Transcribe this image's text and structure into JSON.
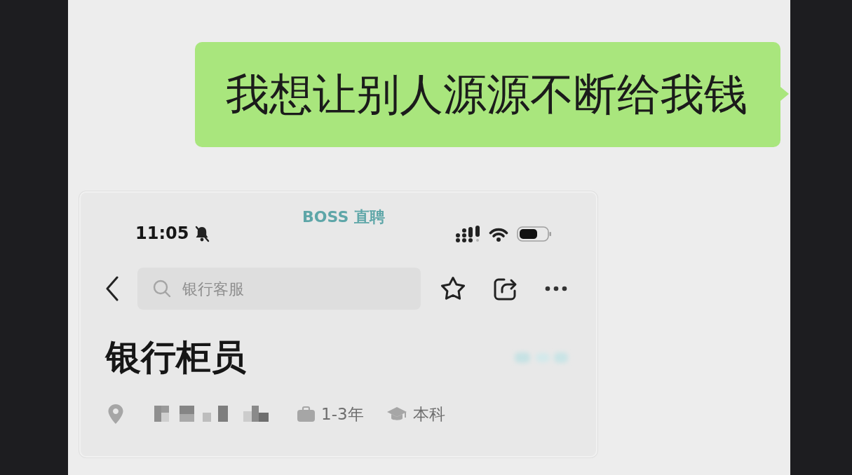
{
  "chat": {
    "messages": [
      {
        "kind": "text",
        "outgoing": true,
        "text": "我想让别人源源不断给我钱"
      },
      {
        "kind": "screenshot",
        "outgoing": false,
        "screenshot": {
          "status_bar": {
            "time": "11:05",
            "muted": true,
            "app_logo": "BOSS 直聘"
          },
          "search": {
            "placeholder": "银行客服"
          },
          "job": {
            "title": "银行柜员",
            "tags": [
              {
                "kind": "experience",
                "text": "1-3年"
              },
              {
                "kind": "education",
                "text": "本科"
              }
            ]
          }
        }
      }
    ]
  }
}
